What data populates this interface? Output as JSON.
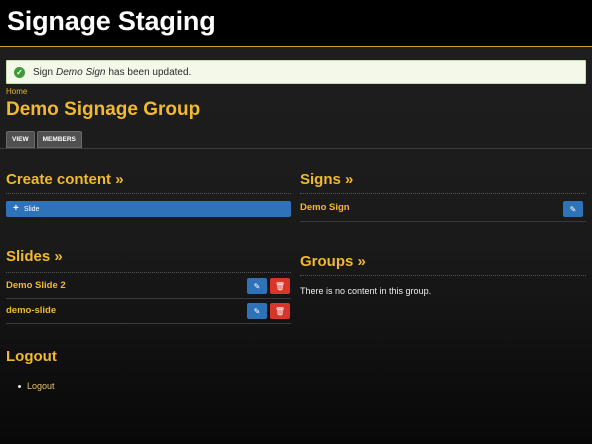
{
  "header": {
    "site_title": "Signage Staging"
  },
  "message": {
    "prefix": "Sign",
    "item": "Demo Sign",
    "suffix": "has been updated."
  },
  "breadcrumb": {
    "home": "Home"
  },
  "page": {
    "title": "Demo Signage Group"
  },
  "tabs": [
    {
      "label": "VIEW"
    },
    {
      "label": "MEMBERS"
    }
  ],
  "create": {
    "title": "Create content »",
    "button_label": "Slide"
  },
  "slides": {
    "title": "Slides »",
    "items": [
      {
        "label": "Demo Slide 2"
      },
      {
        "label": "demo-slide"
      }
    ]
  },
  "signs": {
    "title": "Signs »",
    "items": [
      {
        "label": "Demo Sign"
      }
    ]
  },
  "groups": {
    "title": "Groups »",
    "empty_text": "There is no content in this group."
  },
  "logout": {
    "title": "Logout",
    "link": "Logout"
  },
  "colors": {
    "accent": "#f0b92e",
    "primary": "#2e73b8",
    "danger": "#d9352a",
    "success": "#3e9a36"
  },
  "icons": {
    "edit": "pencil-icon",
    "delete": "trash-icon",
    "status": "check-icon",
    "add": "plus-icon"
  }
}
